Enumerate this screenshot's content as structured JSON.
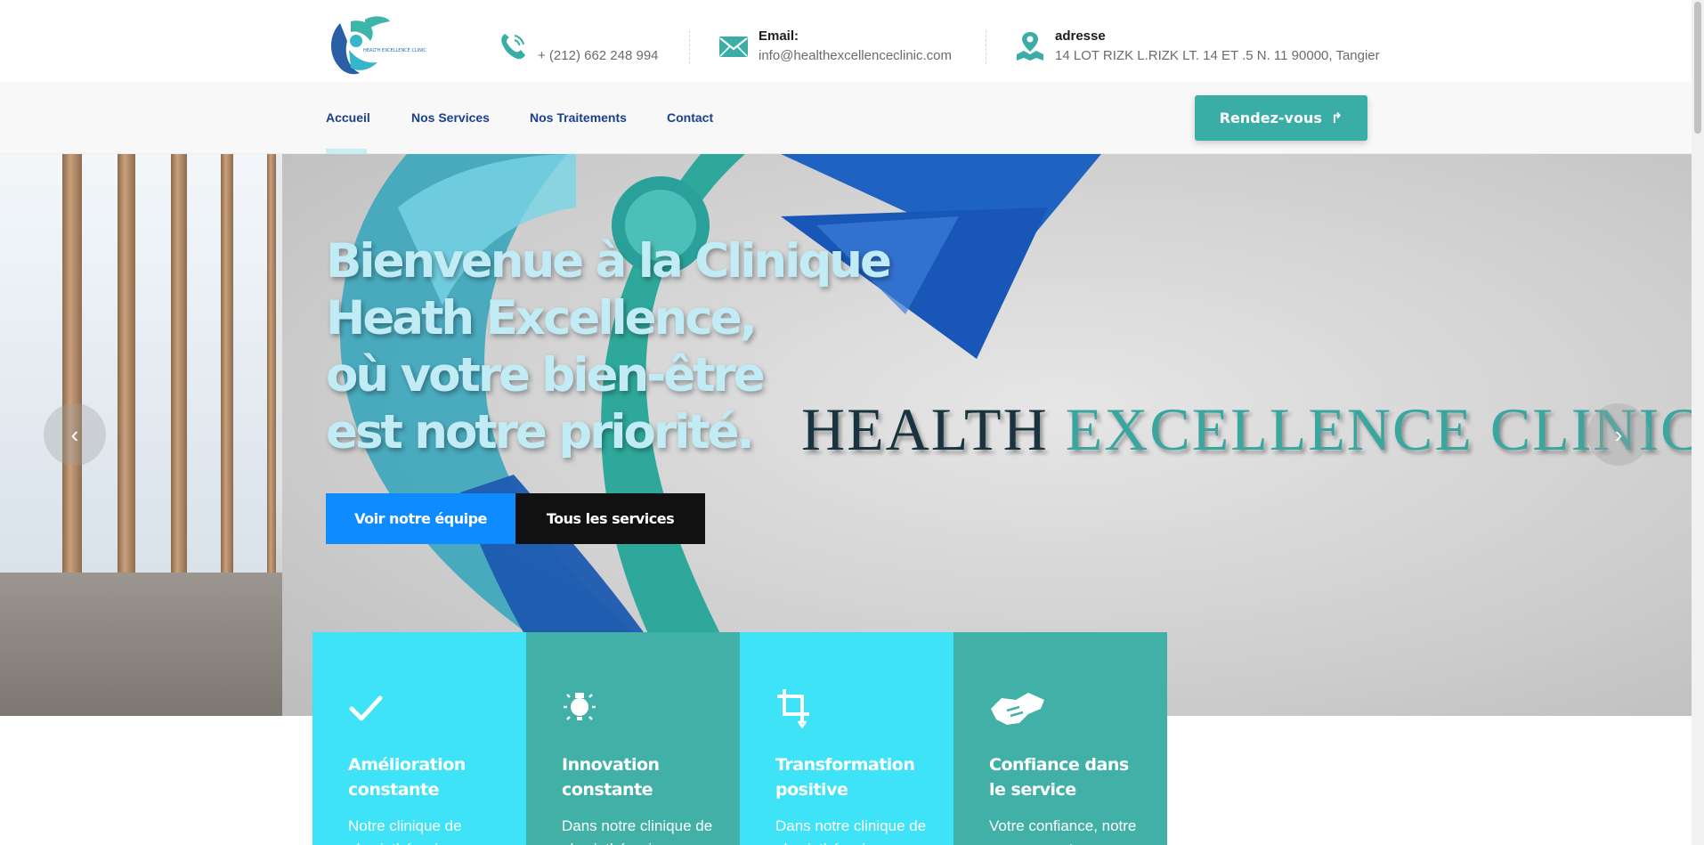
{
  "header": {
    "phone": "+ (212) 662 248 994",
    "email_title": "Email:",
    "email": "info@healthexcellenceclinic.com",
    "address_title": "adresse",
    "address": "14 LOT RIZK L.RIZK LT. 14 ET .5 N. 11 90000, Tangier",
    "icons": [
      "phone-icon",
      "mail-icon",
      "location-icon"
    ]
  },
  "nav": {
    "items": [
      {
        "label": "Accueil",
        "active": true
      },
      {
        "label": "Nos Services",
        "active": false
      },
      {
        "label": "Nos Traitements",
        "active": false
      },
      {
        "label": "Contact",
        "active": false
      }
    ],
    "cta_label": "Rendez-vous"
  },
  "hero": {
    "title_lines": [
      "Bienvenue à la Clinique",
      "Heath Excellence,",
      "où votre bien-être",
      "est notre priorité."
    ],
    "brand_word1": "HEALTH",
    "brand_word2": "EXCELLENCE CLINIC",
    "btn_team": "Voir notre équipe",
    "btn_services": "Tous les services",
    "prev_arrow": "‹",
    "next_arrow": "›"
  },
  "features": [
    {
      "title": "Amélioration constante",
      "text": "Notre clinique de physiothérapie a",
      "icon": "check-icon",
      "bg": "#3fe3f7"
    },
    {
      "title": "Innovation constante",
      "text": "Dans notre clinique de physiothérapie",
      "icon": "lightbulb-icon",
      "bg": "#41b1a7"
    },
    {
      "title": "Transformation positive",
      "text": "Dans notre clinique de physiothérapie",
      "icon": "crop-icon",
      "bg": "#3fe3f7"
    },
    {
      "title": "Confiance dans le service",
      "text": "Votre confiance, notre engagement",
      "icon": "handshake-icon",
      "bg": "#41b1a7"
    }
  ],
  "colors": {
    "accent_teal": "#3aaea6",
    "accent_cyan": "#3fe3f7",
    "nav_text": "#1a3f8c",
    "button_blue": "#0d8bff",
    "button_black": "#111111"
  }
}
